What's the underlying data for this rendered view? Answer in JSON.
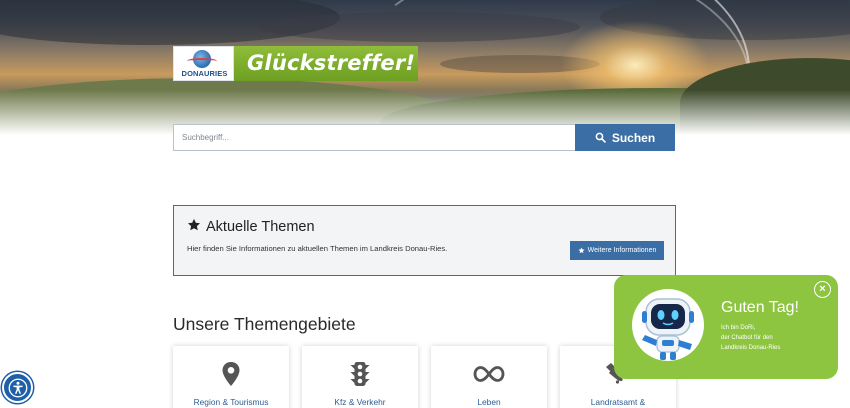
{
  "header": {
    "logo_text": "DONAURIES",
    "claim": "Glückstreffer!"
  },
  "search": {
    "placeholder": "Suchbegriff...",
    "button_label": "Suchen",
    "icon": "search-icon"
  },
  "aktuell": {
    "title": "Aktuelle Themen",
    "text": "Hier finden Sie Informationen zu aktuellen Themen im Landkreis Donau-Ries.",
    "button_label": "Weitere Informationen",
    "icon": "star-icon"
  },
  "themen": {
    "title": "Unsere Themengebiete",
    "tiles": [
      {
        "label": "Region & Tourismus",
        "icon": "location-pin-icon"
      },
      {
        "label": "Kfz & Verkehr",
        "icon": "traffic-light-icon"
      },
      {
        "label": "Leben",
        "icon": "infinity-icon"
      },
      {
        "label": "Landratsamt &",
        "icon": "handshake-icon"
      }
    ]
  },
  "chatbot": {
    "greeting": "Guten Tag!",
    "line1": "Ich bin DoRi,",
    "line2": "der Chatbot für den",
    "line3": "Landkreis Donau-Ries",
    "close_icon": "close-icon",
    "avatar_icon": "robot-icon"
  },
  "accessibility": {
    "icon": "accessibility-icon"
  },
  "colors": {
    "primary_blue": "#3a6ea5",
    "chat_green": "#8dc540",
    "claim_green": "#7aab2b",
    "link_blue": "#2c5d94"
  }
}
